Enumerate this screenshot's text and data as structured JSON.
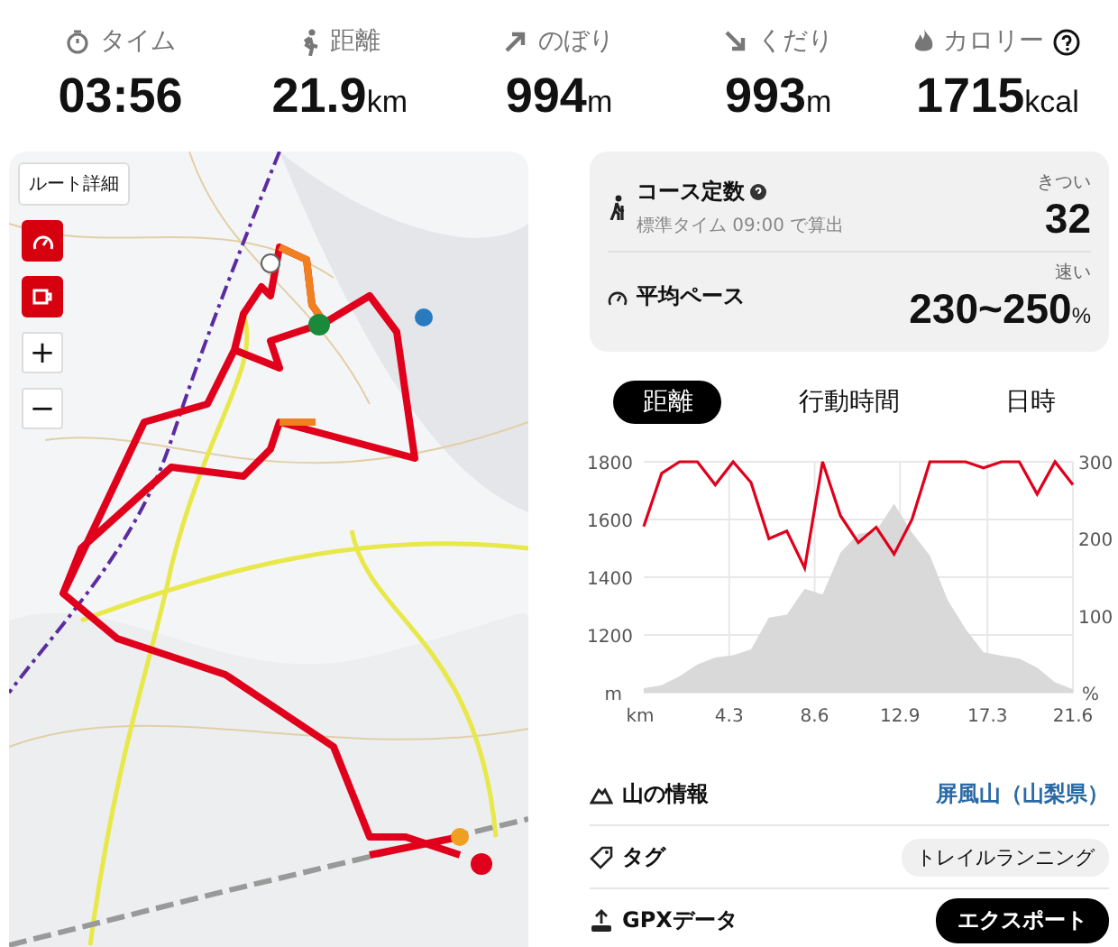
{
  "stats": [
    {
      "kind": "time",
      "label": "タイム",
      "value": "03:56"
    },
    {
      "kind": "distance",
      "label": "距離",
      "value": "21.9",
      "unit": "km"
    },
    {
      "kind": "ascent",
      "label": "のぼり",
      "value": "994",
      "unit": "m"
    },
    {
      "kind": "descent",
      "label": "くだり",
      "value": "993",
      "unit": "m"
    },
    {
      "kind": "calorie",
      "label": "カロリー",
      "value": "1715",
      "unit": "kcal"
    }
  ],
  "map": {
    "controls": [
      {
        "kind": "text",
        "label": "ルート詳細"
      },
      {
        "kind": "speed"
      },
      {
        "kind": "cup"
      },
      {
        "kind": "zoom",
        "label": "+"
      },
      {
        "kind": "zoom",
        "label": "−"
      }
    ]
  },
  "course": {
    "title": "コース定数",
    "note": "標準タイム 09:00 で算出",
    "level_label": "きつい",
    "value": "32"
  },
  "pace": {
    "title": "平均ペース",
    "level_label": "速い",
    "value": "230~250",
    "unit": "%"
  },
  "tabs": [
    {
      "label": "距離",
      "selected": true
    },
    {
      "label": "行動時間",
      "selected": false
    },
    {
      "label": "日時",
      "selected": false
    }
  ],
  "elevation_chart": {
    "chart_data": {
      "type": "area",
      "xlabel": "km",
      "x": [
        0,
        0.9,
        1.8,
        2.7,
        3.6,
        4.5,
        5.4,
        6.3,
        7.2,
        8.1,
        9.0,
        9.9,
        10.8,
        11.7,
        12.6,
        13.5,
        14.4,
        15.3,
        16.2,
        17.1,
        18.0,
        18.9,
        19.8,
        20.7,
        21.6
      ],
      "xlim": [
        0,
        21.6
      ],
      "ylim": [
        1000,
        1800
      ],
      "xticks": [
        4.3,
        8.6,
        12.9,
        17.3,
        21.6
      ],
      "yticks": [
        {
          "value": 1000,
          "label": "m"
        },
        1200,
        1400,
        1600,
        1800
      ],
      "grid": true,
      "series": [
        {
          "color": "#d9d9d9",
          "values": [
            1016,
            1026,
            1057,
            1098,
            1122,
            1130,
            1150,
            1260,
            1270,
            1360,
            1340,
            1485,
            1550,
            1560,
            1655,
            1555,
            1475,
            1320,
            1220,
            1140,
            1128,
            1118,
            1087,
            1036,
            1012
          ]
        }
      ]
    }
  },
  "pace_chart": {
    "chart_data": {
      "type": "line",
      "ylim": [
        0,
        300
      ],
      "yticks": [
        {
          "value": 0,
          "label": "%"
        },
        100,
        200,
        300
      ],
      "series": [
        {
          "color": "#e0001b",
          "values": [
            216,
            285,
            300,
            300,
            270,
            300,
            273,
            200,
            210,
            162,
            300,
            230,
            195,
            215,
            180,
            225,
            300,
            300,
            300,
            292,
            300,
            300,
            258,
            300,
            270
          ]
        }
      ]
    }
  },
  "info_rows": [
    {
      "kind": "mountain",
      "label": "山の情報",
      "value": "屏風山（山梨県）"
    },
    {
      "kind": "tag",
      "label": "タグ",
      "value": "トレイルランニング"
    },
    {
      "kind": "gpx",
      "label": "GPXデータ",
      "value": "エクスポート"
    }
  ]
}
